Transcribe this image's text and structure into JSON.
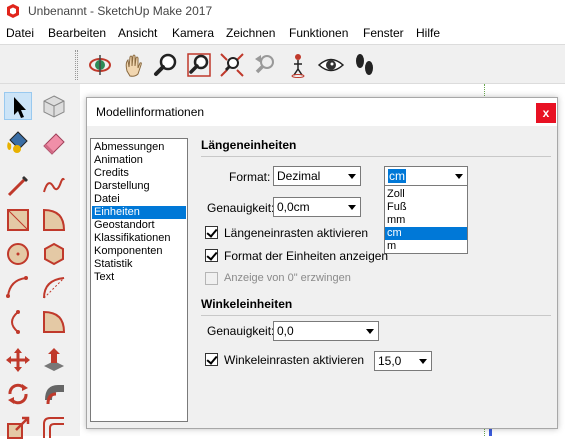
{
  "window": {
    "title": "Unbenannt - SketchUp Make 2017"
  },
  "menu": [
    "Datei",
    "Bearbeiten",
    "Ansicht",
    "Kamera",
    "Zeichnen",
    "Funktionen",
    "Fenster",
    "Hilfe"
  ],
  "toolbar_icons": [
    "orbit-icon",
    "pan-icon",
    "zoom-icon",
    "zoom-window-icon",
    "zoom-extents-icon",
    "previous-view-icon",
    "position-camera-icon",
    "look-around-icon",
    "walk-icon"
  ],
  "left_toolbar_icons": [
    "select-icon",
    "make-component-icon",
    "paint-bucket-icon",
    "eraser-icon",
    "line-icon",
    "freehand-icon",
    "rectangle-icon",
    "rotated-rectangle-icon",
    "circle-icon",
    "polygon-icon",
    "arc-icon",
    "two-point-arc-icon",
    "three-point-arc-icon",
    "pie-icon",
    "move-icon",
    "push-pull-icon",
    "rotate-icon",
    "follow-me-icon",
    "scale-icon",
    "offset-icon"
  ],
  "dialog": {
    "title": "Modellinformationen",
    "close_label": "x",
    "categories": [
      "Abmessungen",
      "Animation",
      "Credits",
      "Darstellung",
      "Datei",
      "Einheiten",
      "Geostandort",
      "Klassifikationen",
      "Komponenten",
      "Statistik",
      "Text"
    ],
    "selected_category": "Einheiten",
    "length": {
      "title": "Längeneinheiten",
      "format_label": "Format:",
      "format_value": "Dezimal",
      "unit_value": "cm",
      "unit_options": [
        "Zoll",
        "Fuß",
        "mm",
        "cm",
        "m"
      ],
      "precision_label": "Genauigkeit:",
      "precision_value": "0,0cm",
      "snap_label": "Längeneinrasten aktivieren",
      "snap_checked": true,
      "show_format_label": "Format der Einheiten anzeigen",
      "show_format_checked": true,
      "force_label": "Anzeige von 0\" erzwingen",
      "force_checked": false
    },
    "angle": {
      "title": "Winkeleinheiten",
      "precision_label": "Genauigkeit:",
      "precision_value": "0,0",
      "snap_label": "Winkeleinrasten aktivieren",
      "snap_checked": true,
      "snap_value": "15,0"
    }
  }
}
